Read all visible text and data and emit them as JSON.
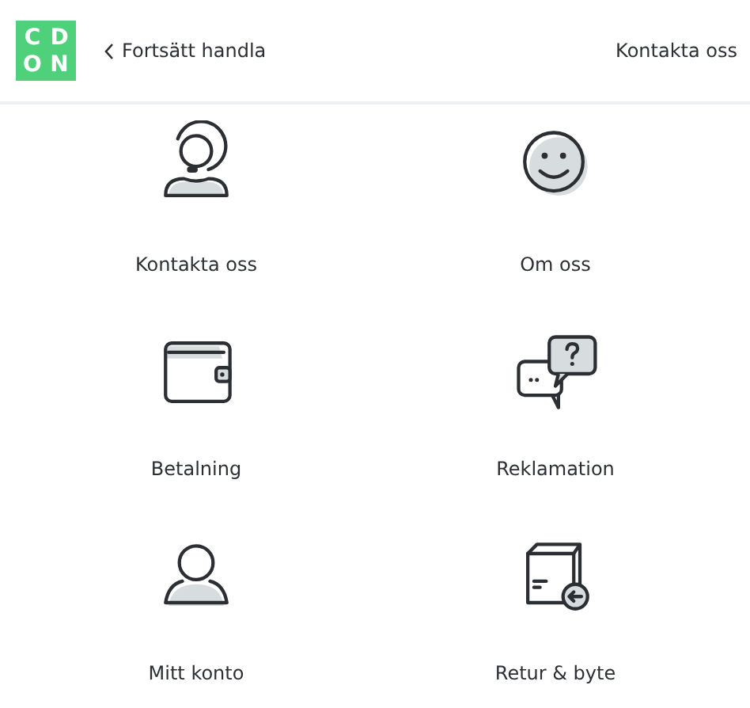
{
  "header": {
    "logo": [
      "C",
      "D",
      "O",
      "N"
    ],
    "back_link": "Fortsätt handla",
    "contact_link": "Kontakta oss"
  },
  "items": [
    {
      "label": "Kontakta oss",
      "kind": "headset"
    },
    {
      "label": "Om oss",
      "kind": "smiley"
    },
    {
      "label": "Betalning",
      "kind": "wallet"
    },
    {
      "label": "Reklamation",
      "kind": "chat"
    },
    {
      "label": "Mitt konto",
      "kind": "person"
    },
    {
      "label": "Retur & byte",
      "kind": "box"
    }
  ]
}
